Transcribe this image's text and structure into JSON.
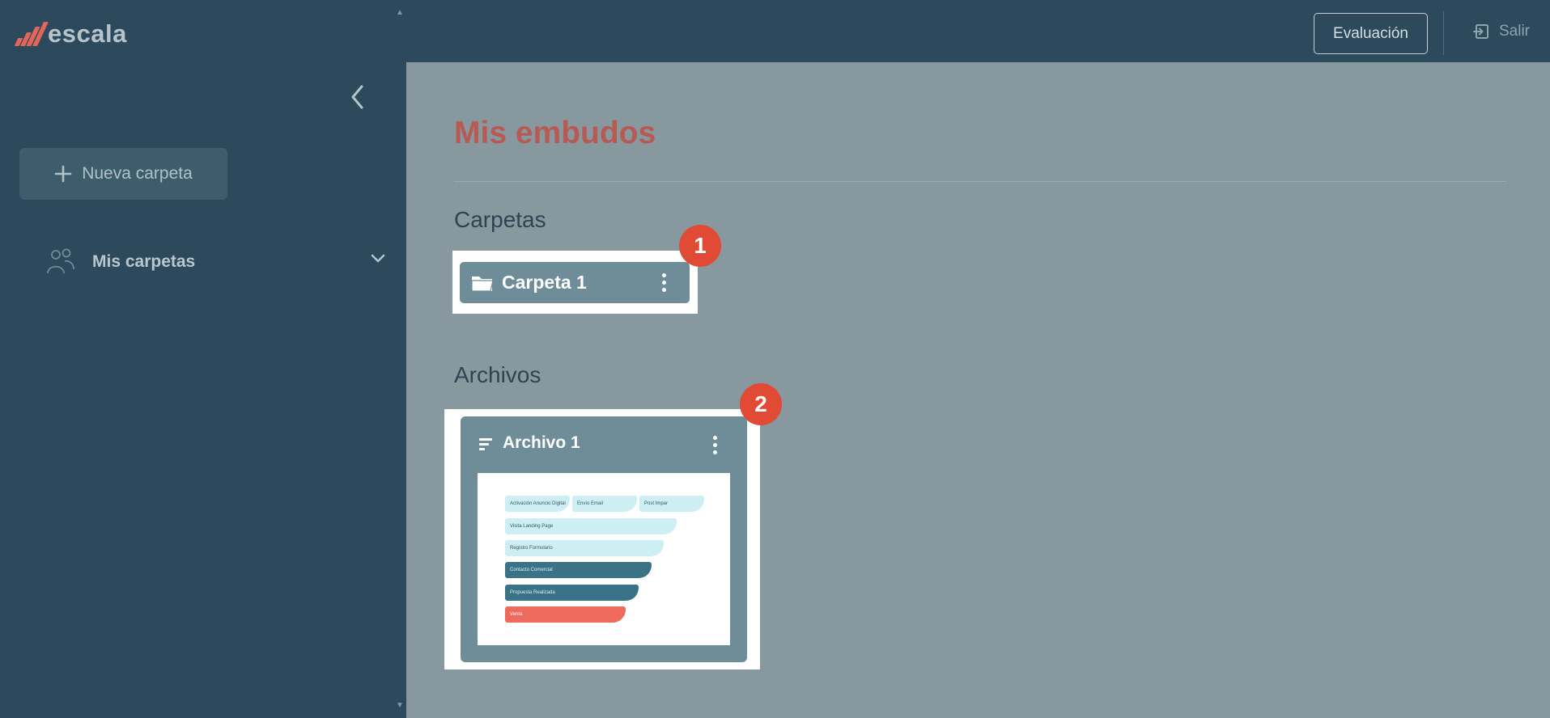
{
  "header": {
    "logo_text": "escala",
    "evaluation_button": "Evaluación",
    "logout_label": "Salir"
  },
  "sidebar": {
    "new_folder_button": "Nueva carpeta",
    "my_folders_label": "Mis carpetas"
  },
  "main": {
    "title": "Mis embudos",
    "folders_section": "Carpetas",
    "files_section": "Archivos",
    "folders": [
      {
        "name": "Carpeta 1"
      }
    ],
    "files": [
      {
        "name": "Archivo 1",
        "preview_stages": [
          {
            "label": "Activación Anuncio Digital",
            "color": "#cdeef2"
          },
          {
            "label": "Envío Email",
            "color": "#cdeef2"
          },
          {
            "label": "Post Impar",
            "color": "#cdeef2"
          },
          {
            "label": "Visita Landing Page",
            "color": "#cdeef2"
          },
          {
            "label": "Registro Formulario",
            "color": "#cdeef2"
          },
          {
            "label": "Contacto Comercial",
            "color": "#3b7386"
          },
          {
            "label": "Propuesta Realizada",
            "color": "#3b7386"
          },
          {
            "label": "Venta",
            "color": "#ee6a5c"
          }
        ]
      }
    ]
  },
  "annotations": {
    "badge_1": "1",
    "badge_2": "2"
  },
  "colors": {
    "sidebar_bg": "#2c4a5b",
    "content_bg": "#87999f",
    "title_color": "#b65a53",
    "card_bg": "#6f8d99",
    "badge_red": "#e14a35",
    "logo_accent": "#e3655a"
  }
}
